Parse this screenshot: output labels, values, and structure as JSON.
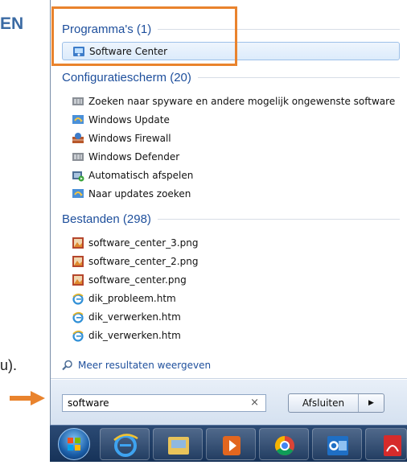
{
  "document": {
    "heading_fragment": "EN",
    "text_fragment": "u)."
  },
  "start_menu": {
    "sections": [
      {
        "title": "Programma's (1)",
        "items": [
          {
            "label": "Software Center",
            "icon": "software-center-icon"
          }
        ]
      },
      {
        "title": "Configuratiescherm (20)",
        "items": [
          {
            "label": "Zoeken naar spyware en andere mogelijk ongewenste software",
            "icon": "windows-defender-icon"
          },
          {
            "label": "Windows Update",
            "icon": "windows-update-icon"
          },
          {
            "label": "Windows Firewall",
            "icon": "firewall-icon"
          },
          {
            "label": "Windows Defender",
            "icon": "windows-defender-icon"
          },
          {
            "label": "Automatisch afspelen",
            "icon": "autoplay-icon"
          },
          {
            "label": "Naar updates zoeken",
            "icon": "windows-update-icon"
          }
        ]
      },
      {
        "title": "Bestanden (298)",
        "items": [
          {
            "label": "software_center_3.png",
            "icon": "image-file-icon"
          },
          {
            "label": "software_center_2.png",
            "icon": "image-file-icon"
          },
          {
            "label": "software_center.png",
            "icon": "image-file-icon"
          },
          {
            "label": "dik_probleem.htm",
            "icon": "ie-file-icon"
          },
          {
            "label": "dik_verwerken.htm",
            "icon": "ie-file-icon"
          },
          {
            "label": "dik_verwerken.htm",
            "icon": "ie-file-icon"
          }
        ]
      }
    ],
    "more_results": "Meer resultaten weergeven",
    "search": {
      "value": "software",
      "clear_icon": "×"
    },
    "shutdown": {
      "label": "Afsluiten",
      "arrow": "▶"
    }
  },
  "taskbar": {
    "buttons": [
      {
        "name": "start-orb"
      },
      {
        "name": "internet-explorer"
      },
      {
        "name": "windows-explorer"
      },
      {
        "name": "media-player"
      },
      {
        "name": "chrome"
      },
      {
        "name": "outlook"
      },
      {
        "name": "acrobat"
      }
    ]
  },
  "colors": {
    "highlight_box": "#e9832d",
    "section_title": "#1e4f9c",
    "taskbar": "#1d3b64"
  }
}
